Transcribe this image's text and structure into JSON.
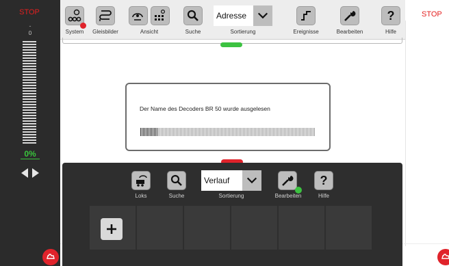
{
  "left_panel": {
    "stop_label": "STOP",
    "speed_value": "0",
    "speed_percent": "0%",
    "speed_fraction": 0
  },
  "right_panel": {
    "stop_label": "STOP"
  },
  "top_toolbar": {
    "system_label": "System",
    "layouts_label": "Gleisbilder",
    "view_label": "Ansicht",
    "search_label": "Suche",
    "sort_value": "Adresse",
    "sort_label": "Sortierung",
    "events_label": "Ereignisse",
    "edit_label": "Bearbeiten",
    "help_label": "Hilfe"
  },
  "dialog": {
    "message": "Der Name des Decoders BR 50 wurde ausgelesen",
    "progress_fraction": 0.1
  },
  "loco_drawer": {
    "locos_label": "Loks",
    "search_label": "Suche",
    "sort_value": "Verlauf",
    "sort_label": "Sortierung",
    "edit_label": "Bearbeiten",
    "help_label": "Hilfe"
  },
  "colors": {
    "stop": "#e0232b",
    "accent_green": "#3cc241",
    "panel_dark": "#2b2b2b"
  },
  "icons": [
    "system-icon",
    "layouts-icon",
    "view-icon",
    "search-icon",
    "chevron-down-icon",
    "events-icon",
    "wrench-icon",
    "help-icon",
    "loco-icon",
    "plus-icon",
    "stop-button-icon"
  ]
}
